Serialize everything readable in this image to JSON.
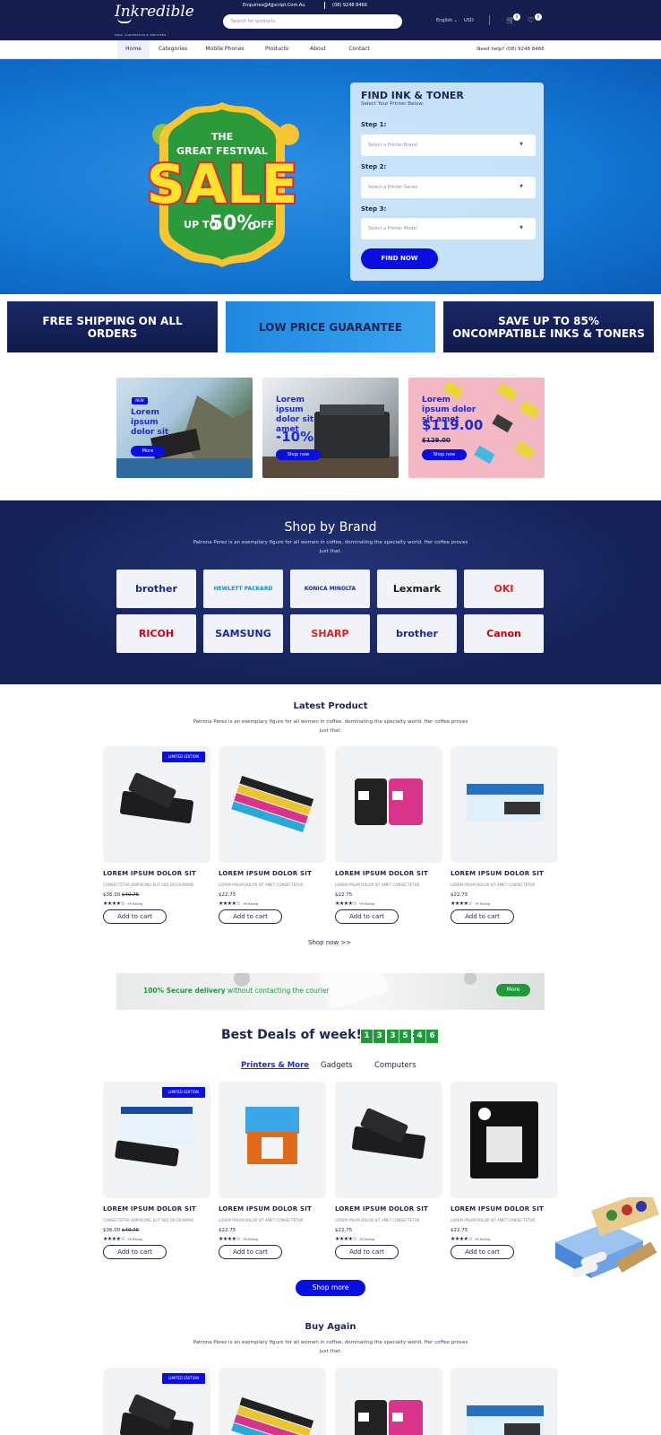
{
  "header": {
    "logo": "Inkredible",
    "tagline": "INKS, CARTRIDGES & PRINTERS",
    "email": "Enquiries@Ajjscript.Com.Au",
    "phone": "(08) 9248 8466",
    "search_placeholder": "Search for products",
    "language": "English",
    "currency": "USD",
    "cart_count": "0",
    "wishlist_count": "0"
  },
  "nav": {
    "items": [
      "Home",
      "Categories",
      "Mobile Phones",
      "Products",
      "About",
      "Contact"
    ],
    "help": "Need help? (08) 9248 8466"
  },
  "hero": {
    "sale_line1": "THE",
    "sale_line2": "GREAT FESTIVAL",
    "sale_word": "SALE",
    "sale_upto": "UP TO",
    "sale_pct": "50%",
    "sale_off": "OFF",
    "finder_title": "FIND INK & TONER",
    "finder_sub": "Select Your Printer Below:",
    "step1": "Step 1:",
    "step1_placeholder": "Select a Printer Brand",
    "step2": "Step 2:",
    "step2_placeholder": "Select a Printer Series",
    "step3": "Step 3:",
    "step3_placeholder": "Select a Printer Model",
    "find_button": "FIND NOW"
  },
  "promos": [
    "FREE SHIPPING ON ALL ORDERS",
    "LOW PRICE GUARANTEE",
    "SAVE UP TO 85% ONCOMPATIBLE INKS & TONERS"
  ],
  "banners": [
    {
      "badge": "NEW",
      "text": "Lorem ipsum dolor sit",
      "button": "More"
    },
    {
      "text": "Lorem ipsum dolor sit amet",
      "discount": "-10%",
      "button": "Shop now"
    },
    {
      "text": "Lorem ipsum dolor sit amet",
      "price": "$119.00",
      "old_price": "$129.00",
      "button": "Shop now"
    }
  ],
  "brands": {
    "title": "Shop by Brand",
    "desc": "Patrona Perez is an exemplary figure for all women in coffee, dominating the specialty world. Her coffee proves just that.",
    "items": [
      {
        "name": "brother",
        "color": "#1a2a8a"
      },
      {
        "name": "HEWLETT PACKARD",
        "color": "#0096d6"
      },
      {
        "name": "KONICA MINOLTA",
        "color": "#1a2a8a"
      },
      {
        "name": "Lexmark",
        "color": "#1a1a1a"
      },
      {
        "name": "OKI",
        "color": "#e02020"
      },
      {
        "name": "RICOH",
        "color": "#d4001a"
      },
      {
        "name": "SAMSUNG",
        "color": "#1428a0"
      },
      {
        "name": "SHARP",
        "color": "#e02020"
      },
      {
        "name": "brother",
        "color": "#1a2a8a"
      },
      {
        "name": "Canon",
        "color": "#cc0000"
      }
    ]
  },
  "latest": {
    "title": "Latest Product",
    "desc": "Patrona Perez is an exemplary figure for all women in coffee, dominating the specialty world. Her coffee proves just that.",
    "limited": "LIMITED EDITION",
    "products": [
      {
        "name": "LOREM IPSUM DOLOR SIT",
        "sub": "CONSECTETUR ADIPISCING ELIT SED DO EIUSMOD",
        "price": "$36.00",
        "old": "$40.75",
        "rating": 4,
        "reviews": "99 Rating"
      },
      {
        "name": "LOREM IPSUM DOLOR SIT",
        "sub": "LOREM IPSUM DOLOR SIT AMET CONSECTETUR",
        "price": "$22.75",
        "old": "",
        "rating": 4,
        "reviews": "99 Rating"
      },
      {
        "name": "LOREM IPSUM DOLOR SIT",
        "sub": "LOREM IPSUM DOLOR SIT AMET CONSECTETUR",
        "price": "$22.75",
        "old": "",
        "rating": 4,
        "reviews": "99 Rating"
      },
      {
        "name": "LOREM IPSUM DOLOR SIT",
        "sub": "LOREM IPSUM DOLOR SIT AMET CONSECTETUR",
        "price": "$22.75",
        "old": "",
        "rating": 4,
        "reviews": "99 Rating"
      }
    ],
    "add_to_cart": "Add to cart",
    "shop_now": "Shop now  >>"
  },
  "secure": {
    "bold": "100% Secure delivery",
    "rest": " without contacting the courier",
    "button": "More"
  },
  "deals": {
    "title": "Best Deals of week!",
    "timer": [
      "1",
      "3",
      "3",
      "5",
      "4",
      "6"
    ],
    "tabs": [
      "Printers & More",
      "Gadgets",
      "Computers"
    ],
    "products": [
      {
        "name": "LOREM IPSUM DOLOR SIT",
        "sub": "CONSECTETUR ADIPISCING ELIT SED DO EIUSMOD",
        "price": "$36.00",
        "old": "$40.75",
        "rating": 4,
        "reviews": "99 Rating"
      },
      {
        "name": "LOREM IPSUM DOLOR SIT",
        "sub": "LOREM IPSUM DOLOR SIT AMET CONSECTETUR",
        "price": "$22.75",
        "old": "",
        "rating": 4,
        "reviews": "99 Rating"
      },
      {
        "name": "LOREM IPSUM DOLOR SIT",
        "sub": "LOREM IPSUM DOLOR SIT AMET CONSECTETUR",
        "price": "$22.75",
        "old": "",
        "rating": 4,
        "reviews": "99 Rating"
      },
      {
        "name": "LOREM IPSUM DOLOR SIT",
        "sub": "LOREM IPSUM DOLOR SIT AMET CONSECTETUR",
        "price": "$22.75",
        "old": "",
        "rating": 4,
        "reviews": "99 Rating"
      }
    ],
    "shop_more": "Shop more"
  },
  "buy_again": {
    "title": "Buy Again",
    "desc": "Patrona Perez is an exemplary figure for all women in coffee, dominating the specialty world. Her coffee proves just that."
  }
}
